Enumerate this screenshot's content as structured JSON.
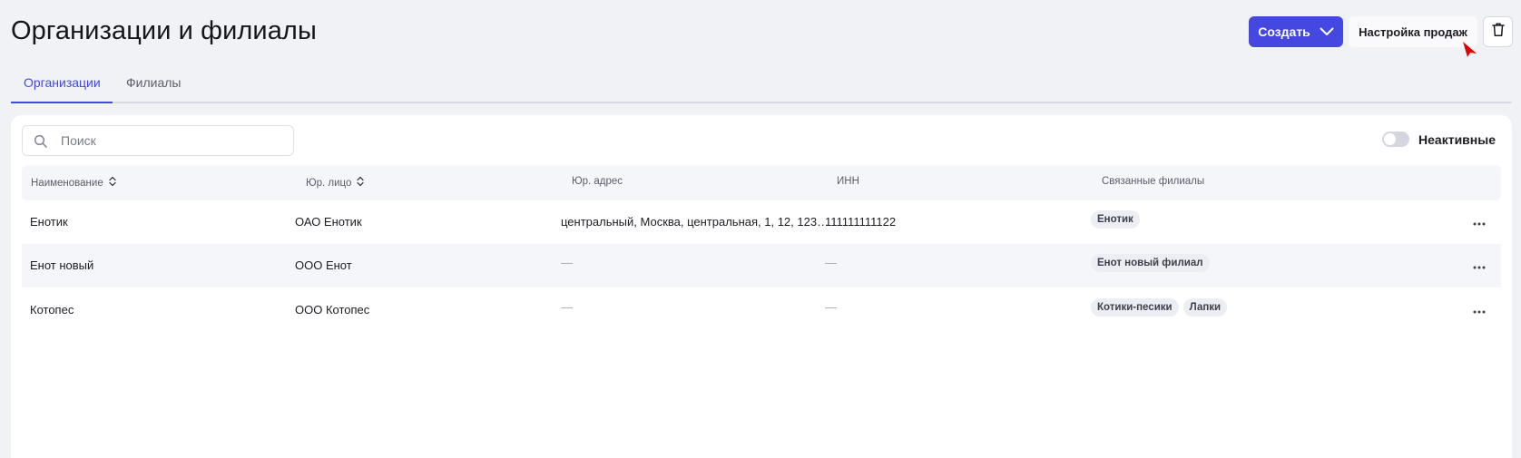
{
  "header": {
    "title": "Организации и филиалы",
    "create_label": "Создать",
    "sales_settings_label": "Настройка продаж"
  },
  "tabs": [
    {
      "label": "Организации",
      "active": true
    },
    {
      "label": "Филиалы",
      "active": false
    }
  ],
  "toolbar": {
    "search_placeholder": "Поиск",
    "inactive_toggle_label": "Неактивные",
    "inactive_toggle_on": false
  },
  "table": {
    "columns": [
      "Наименование",
      "Юр. лицо",
      "Юр. адрес",
      "ИНН",
      "Связанные филиалы"
    ],
    "rows": [
      {
        "name": "Енотик",
        "legal_entity": "ОАО Енотик",
        "address": "центральный, Москва, центральная, 1, 12, 123…",
        "inn": "111111111122",
        "branches": [
          "Енотик"
        ]
      },
      {
        "name": "Енот новый",
        "legal_entity": "ООО Енот",
        "address": "—",
        "inn": "—",
        "branches": [
          "Енот новый филиал"
        ]
      },
      {
        "name": "Котопес",
        "legal_entity": "ООО Котопес",
        "address": "—",
        "inn": "—",
        "branches": [
          "Котики-песики",
          "Лапки"
        ]
      }
    ]
  },
  "colors": {
    "accent": "#4548e0",
    "background": "#f1f2f6",
    "cursor": "#e00000"
  }
}
